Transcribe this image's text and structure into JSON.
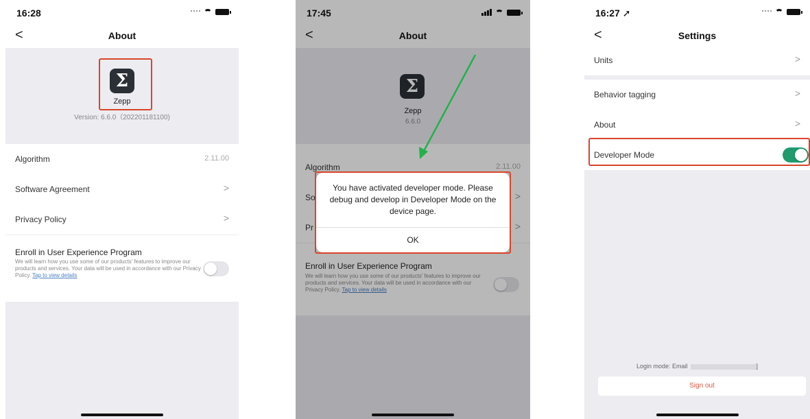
{
  "phones": [
    {
      "status_time": "16:28",
      "nav_title": "About",
      "back_glyph": "<",
      "app_name": "Zepp",
      "app_icon_glyph": "Σ",
      "version": "Version: 6.6.0（202201181100)",
      "rows": [
        {
          "label": "Algorithm",
          "value": "2.11.00"
        },
        {
          "label": "Software Agreement",
          "chevron": ">"
        },
        {
          "label": "Privacy Policy",
          "chevron": ">"
        }
      ],
      "enroll": {
        "title": "Enroll in User Experience Program",
        "desc": "We will learn how you use some of our products' features to improve our products and services. Your data will be used in accordance with our Privacy Policy. ",
        "link": "Tap to view details",
        "enabled": false
      }
    },
    {
      "status_time": "17:45",
      "nav_title": "About",
      "back_glyph": "<",
      "app_name": "Zepp",
      "app_icon_glyph": "Σ",
      "version": "6.6.0",
      "rows": [
        {
          "label": "Algorithm",
          "value": "2.11.00"
        },
        {
          "label": "So",
          "chevron": ">"
        },
        {
          "label": "Pr",
          "chevron": ">"
        }
      ],
      "enroll": {
        "title": "Enroll in User Experience Program",
        "desc": "We will learn how you use some of our products' features to improve our products and services. Your data will be used in accordance with our Privacy Policy. ",
        "link": "Tap to view details",
        "enabled": false
      },
      "dialog": {
        "message": "You have activated developer mode. Please debug and develop in Developer Mode on the device page.",
        "ok_label": "OK"
      }
    },
    {
      "status_time": "16:27 ➚",
      "nav_title": "Settings",
      "back_glyph": "<",
      "rows": [
        {
          "label": "Units",
          "chevron": ">"
        },
        {
          "label": "Behavior tagging",
          "chevron": ">"
        },
        {
          "label": "About",
          "chevron": ">"
        },
        {
          "label": "Developer Mode",
          "enabled": true
        }
      ],
      "login_mode": "Login mode: Email",
      "login_suffix": "]",
      "sign_out": "Sign out"
    }
  ],
  "colors": {
    "highlight": "#d9452a",
    "arrow": "#22b14c",
    "toggle_on": "#1f9b6e",
    "sign_out": "#e0553d"
  }
}
